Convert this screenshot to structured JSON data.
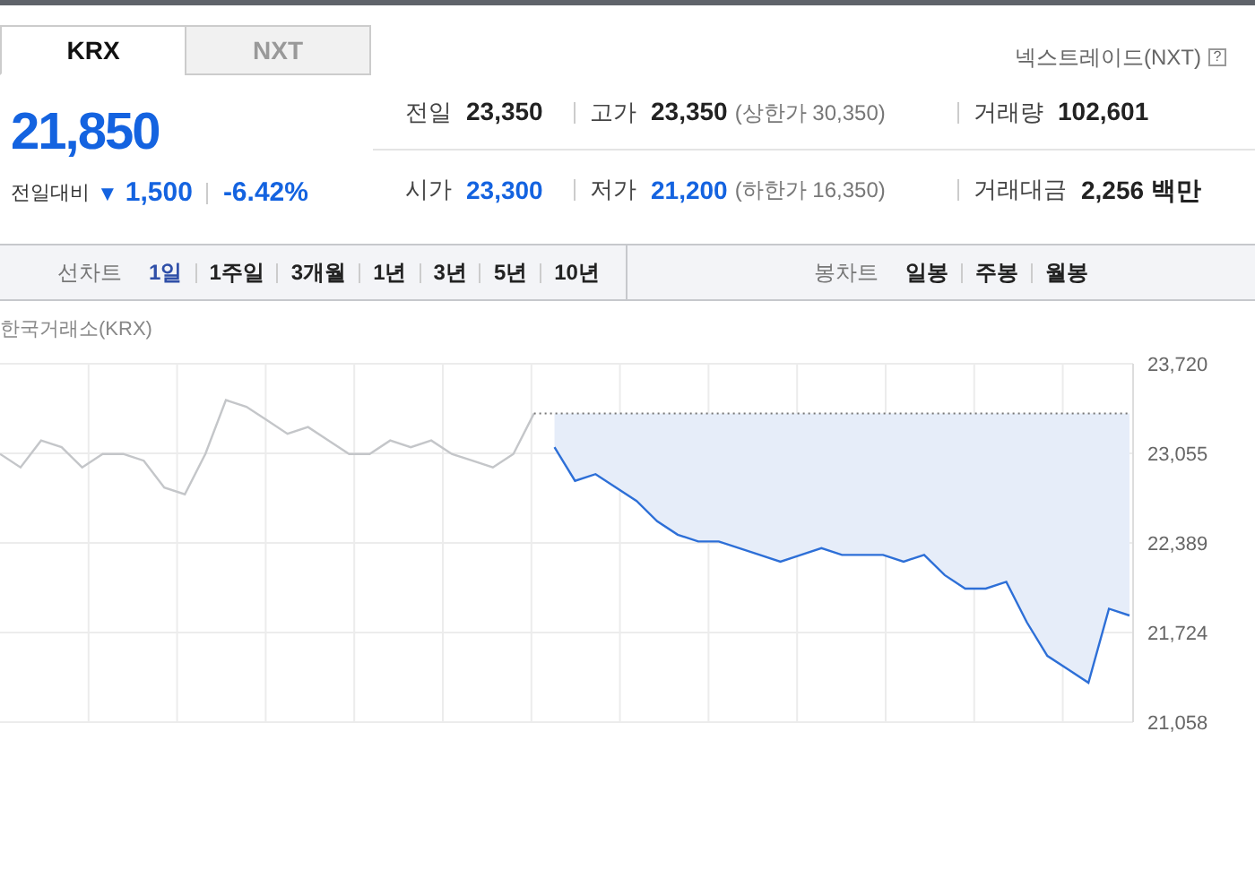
{
  "market_tabs": [
    {
      "label": "KRX",
      "selected": true
    },
    {
      "label": "NXT",
      "selected": false
    }
  ],
  "nxt_link": {
    "label": "넥스트레이드(NXT)",
    "help": "?"
  },
  "quote": {
    "price": "21,850",
    "color": "#1463e0",
    "change_label": "전일대비",
    "change_icon": "▼",
    "change": "1,500",
    "change_rate": "-6.42%"
  },
  "stats": [
    {
      "label": "전일",
      "value": "23,350",
      "color": "#222222"
    },
    {
      "label": "고가",
      "value": "23,350",
      "color": "#222222",
      "note": "(상한가 30,350)"
    },
    {
      "label": "거래량",
      "value": "102,601",
      "color": "#222222"
    },
    {
      "label": "시가",
      "value": "23,300",
      "color": "#1463e0"
    },
    {
      "label": "저가",
      "value": "21,200",
      "color": "#1463e0",
      "note": "(하한가 16,350)"
    },
    {
      "label": "거래대금",
      "value": "2,256 백만",
      "color": "#222222"
    }
  ],
  "line_chart_menu": {
    "label": "선차트",
    "periods": [
      {
        "label": "1일",
        "selected": true
      },
      {
        "label": "1주일",
        "selected": false
      },
      {
        "label": "3개월",
        "selected": false
      },
      {
        "label": "1년",
        "selected": false
      },
      {
        "label": "3년",
        "selected": false
      },
      {
        "label": "5년",
        "selected": false
      },
      {
        "label": "10년",
        "selected": false
      }
    ]
  },
  "candle_chart_menu": {
    "label": "봉차트",
    "periods": [
      {
        "label": "일봉",
        "selected": false
      },
      {
        "label": "주봉",
        "selected": false
      },
      {
        "label": "월봉",
        "selected": false
      }
    ]
  },
  "chart_caption": "한국거래소(KRX)",
  "chart_data": {
    "type": "line",
    "grid": true,
    "ylim": [
      21058,
      23720
    ],
    "yticks": [
      {
        "value": 23720,
        "label": "23,720"
      },
      {
        "value": 23055,
        "label": "23,055"
      },
      {
        "value": 22389,
        "label": "22,389"
      },
      {
        "value": 21724,
        "label": "21,724"
      },
      {
        "value": 21058,
        "label": "21,058"
      }
    ],
    "series": [
      {
        "color": "#c4c6c9",
        "values": [
          23050,
          22950,
          23150,
          23100,
          22950,
          23050,
          23050,
          23000,
          22800,
          22750,
          23050,
          23450,
          23400,
          23300,
          23200,
          23250,
          23150,
          23050,
          23050,
          23150,
          23100,
          23150,
          23050,
          23000,
          22950,
          23050,
          23350,
          null,
          null,
          null,
          null,
          null,
          null,
          null,
          null,
          null,
          null,
          null,
          null,
          null,
          null,
          null,
          null,
          null,
          null,
          null,
          null,
          null,
          null,
          null,
          null,
          null,
          null,
          null,
          null,
          null
        ]
      },
      {
        "color": "#2d6fd7",
        "values": [
          null,
          null,
          null,
          null,
          null,
          null,
          null,
          null,
          null,
          null,
          null,
          null,
          null,
          null,
          null,
          null,
          null,
          null,
          null,
          null,
          null,
          null,
          null,
          null,
          null,
          null,
          null,
          23100,
          22850,
          22900,
          22800,
          22700,
          22550,
          22450,
          22400,
          22400,
          22350,
          22300,
          22250,
          22300,
          22350,
          22300,
          22300,
          22300,
          22250,
          22300,
          22150,
          22050,
          22050,
          22100,
          21800,
          21550,
          21450,
          21350,
          21900,
          21850
        ]
      },
      {
        "color": "#777777",
        "line_style": "dotted",
        "values": [
          null,
          null,
          null,
          null,
          null,
          null,
          null,
          null,
          null,
          null,
          null,
          null,
          null,
          null,
          null,
          null,
          null,
          null,
          null,
          null,
          null,
          null,
          null,
          null,
          null,
          null,
          23350,
          23350,
          23350,
          23350,
          23350,
          23350,
          23350,
          23350,
          23350,
          23350,
          23350,
          23350,
          23350,
          23350,
          23350,
          23350,
          23350,
          23350,
          23350,
          23350,
          23350,
          23350,
          23350,
          23350,
          23350,
          23350,
          23350,
          23350,
          23350,
          23350
        ]
      }
    ]
  }
}
